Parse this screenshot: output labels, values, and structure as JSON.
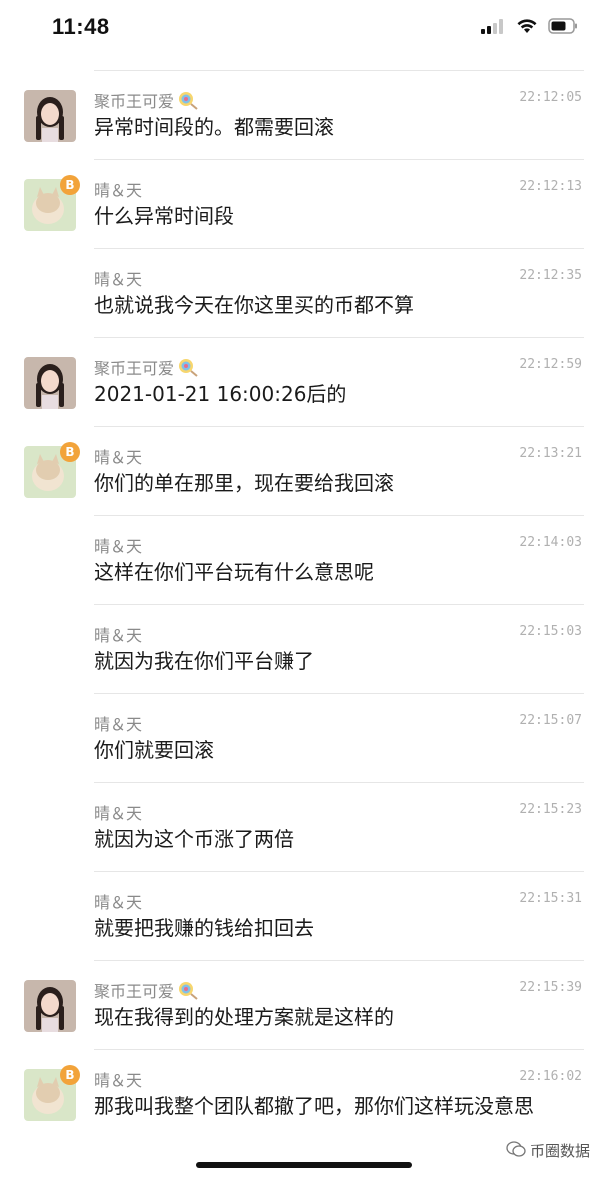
{
  "status_bar": {
    "time": "11:48",
    "icons": [
      "signal-icon",
      "wifi-icon",
      "battery-icon"
    ]
  },
  "messages": [
    {
      "sender": "聚币王可爱",
      "time": "22:12:05",
      "text": "异常时间段的。都需要回滚",
      "avatar": "girl-avatar",
      "emoji": "lollipop-icon"
    },
    {
      "sender": "晴＆天",
      "time": "22:12:13",
      "text": "什么异常时间段",
      "avatar": "cat-avatar",
      "badge": "B"
    },
    {
      "sender": "晴＆天",
      "time": "22:12:35",
      "text": "也就说我今天在你这里买的币都不算"
    },
    {
      "sender": "聚币王可爱",
      "time": "22:12:59",
      "text": "2021-01-21 16:00:26后的",
      "avatar": "girl-avatar",
      "emoji": "lollipop-icon"
    },
    {
      "sender": "晴＆天",
      "time": "22:13:21",
      "text": "你们的单在那里，现在要给我回滚",
      "avatar": "cat-avatar",
      "badge": "B"
    },
    {
      "sender": "晴＆天",
      "time": "22:14:03",
      "text": "这样在你们平台玩有什么意思呢"
    },
    {
      "sender": "晴＆天",
      "time": "22:15:03",
      "text": "就因为我在你们平台赚了"
    },
    {
      "sender": "晴＆天",
      "time": "22:15:07",
      "text": "你们就要回滚"
    },
    {
      "sender": "晴＆天",
      "time": "22:15:23",
      "text": "就因为这个币涨了两倍"
    },
    {
      "sender": "晴＆天",
      "time": "22:15:31",
      "text": "就要把我赚的钱给扣回去"
    },
    {
      "sender": "聚币王可爱",
      "time": "22:15:39",
      "text": "现在我得到的处理方案就是这样的",
      "avatar": "girl-avatar",
      "emoji": "lollipop-icon"
    },
    {
      "sender": "晴＆天",
      "time": "22:16:02",
      "text": "那我叫我整个团队都撤了吧，那你们这样玩没意思",
      "avatar": "cat-avatar",
      "badge": "B"
    }
  ],
  "watermark": "币圈数据"
}
